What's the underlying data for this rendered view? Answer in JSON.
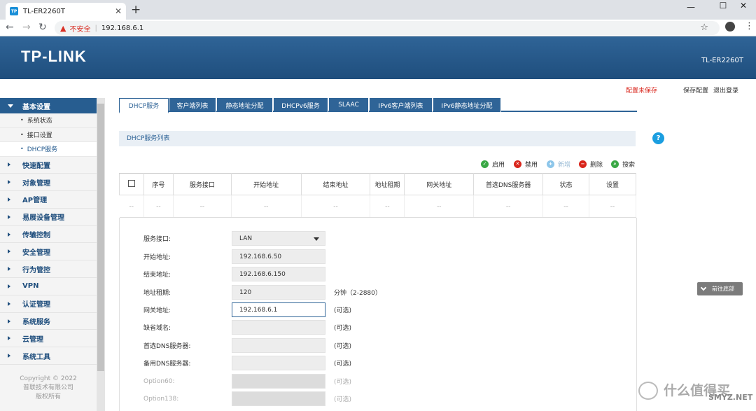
{
  "browser": {
    "tab_title": "TL-ER2260T",
    "tab_favicon": "TP",
    "insecure_label": "不安全",
    "url": "192.168.6.1",
    "icons": [
      "back-icon",
      "forward-icon",
      "reload-icon",
      "warning-icon",
      "star-icon",
      "account-icon",
      "menu-icon",
      "minimize-icon",
      "maximize-icon",
      "close-icon"
    ]
  },
  "header": {
    "logo": "TP-LINK",
    "model": "TL-ER2260T",
    "unsaved": "配置未保存",
    "save": "保存配置",
    "logout": "退出登录"
  },
  "sidebar": {
    "group": {
      "label": "基本设置",
      "items": [
        {
          "label": "系统状态",
          "active": false
        },
        {
          "label": "接口设置",
          "active": false
        },
        {
          "label": "DHCP服务",
          "active": true
        }
      ]
    },
    "items": [
      {
        "label": "快速配置"
      },
      {
        "label": "对象管理"
      },
      {
        "label": "AP管理"
      },
      {
        "label": "易展设备管理"
      },
      {
        "label": "传输控制"
      },
      {
        "label": "安全管理"
      },
      {
        "label": "行为管控"
      },
      {
        "label": "VPN"
      },
      {
        "label": "认证管理"
      },
      {
        "label": "系统服务"
      },
      {
        "label": "云管理"
      },
      {
        "label": "系统工具"
      }
    ],
    "copyright": [
      "Copyright © 2022",
      "普联技术有限公司",
      "版权所有"
    ]
  },
  "tabs": [
    {
      "label": "DHCP服务",
      "active": true
    },
    {
      "label": "客户端列表"
    },
    {
      "label": "静态地址分配"
    },
    {
      "label": "DHCPv6服务"
    },
    {
      "label": "SLAAC"
    },
    {
      "label": "IPv6客户端列表"
    },
    {
      "label": "IPv6静态地址分配"
    }
  ],
  "section_title": "DHCP服务列表",
  "toolbar": {
    "enable": "启用",
    "disable": "禁用",
    "add": "新增",
    "delete": "删除",
    "search": "搜索"
  },
  "table": {
    "headers": [
      "序号",
      "服务接口",
      "开始地址",
      "结束地址",
      "地址租期",
      "网关地址",
      "首选DNS服务器",
      "状态",
      "设置"
    ],
    "row": [
      "--",
      "--",
      "--",
      "--",
      "--",
      "--",
      "--",
      "--",
      "--",
      "--"
    ]
  },
  "form": {
    "interface": {
      "label": "服务接口:",
      "value": "LAN"
    },
    "start": {
      "label": "开始地址:",
      "value": "192.168.6.50"
    },
    "end": {
      "label": "结束地址:",
      "value": "192.168.6.150"
    },
    "lease": {
      "label": "地址租期:",
      "value": "120",
      "hint": "分钟（2-2880）"
    },
    "gateway": {
      "label": "网关地址:",
      "value": "192.168.6.1",
      "hint": "(可选)"
    },
    "domain": {
      "label": "缺省域名:",
      "value": "",
      "hint": "(可选)"
    },
    "dns1": {
      "label": "首选DNS服务器:",
      "value": "",
      "hint": "(可选)"
    },
    "dns2": {
      "label": "备用DNS服务器:",
      "value": "",
      "hint": "(可选)"
    },
    "opt60": {
      "label": "Option60:",
      "value": "",
      "hint": "(可选)"
    },
    "opt138": {
      "label": "Option138:",
      "value": "",
      "hint": "(可选)"
    }
  },
  "jump_bottom": "前往底部",
  "help": "?",
  "watermark": {
    "text": "什么值得买",
    "url": "SMYZ.NET"
  },
  "colors": {
    "brand": "#2f6497",
    "unsaved": "#d9261c",
    "enable": "#3aa845",
    "disable": "#d9261c",
    "add": "#8dc6ea",
    "delete": "#d9261c",
    "search": "#3aa845",
    "help": "#1b9ee0"
  }
}
